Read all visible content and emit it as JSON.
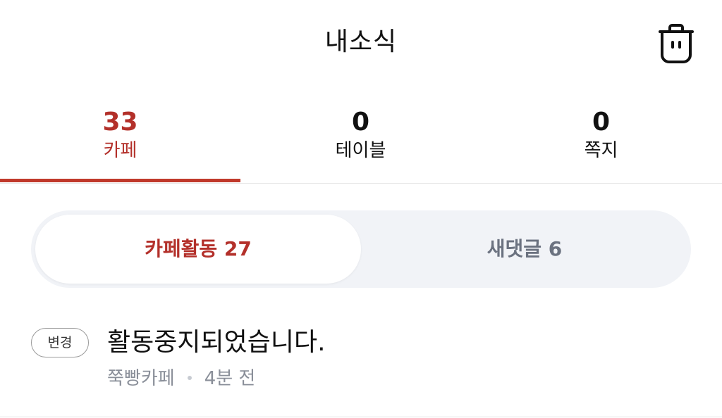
{
  "header": {
    "title": "내소식",
    "trash_icon": "trash-icon"
  },
  "tabs": [
    {
      "count": "33",
      "label": "카페",
      "active": true
    },
    {
      "count": "0",
      "label": "테이블",
      "active": false
    },
    {
      "count": "0",
      "label": "쪽지",
      "active": false
    }
  ],
  "segment": {
    "active_label": "카페활동 27",
    "inactive_label": "새댓글 6"
  },
  "notification": {
    "badge": "변경",
    "title": "활동중지되었습니다.",
    "source": "쭉빵카페",
    "time": "4분 전"
  },
  "colors": {
    "accent": "#b3302a",
    "segment_bg": "#f1f3f7",
    "muted": "#8a8f99"
  }
}
